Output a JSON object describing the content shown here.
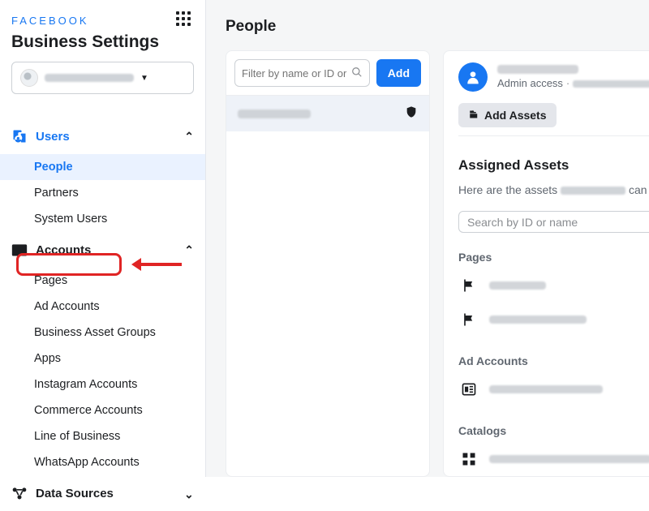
{
  "brand": "FACEBOOK",
  "settings_title": "Business Settings",
  "business_name_blurred": true,
  "sidebar": {
    "sections": [
      {
        "id": "users",
        "label": "Users",
        "accent": true,
        "expanded": true,
        "items": [
          {
            "id": "people",
            "label": "People",
            "active": true
          },
          {
            "id": "partners",
            "label": "Partners",
            "active": false
          },
          {
            "id": "system-users",
            "label": "System Users",
            "active": false
          }
        ]
      },
      {
        "id": "accounts",
        "label": "Accounts",
        "accent": false,
        "expanded": true,
        "items": [
          {
            "id": "pages",
            "label": "Pages",
            "highlight": true
          },
          {
            "id": "ad-accounts",
            "label": "Ad Accounts"
          },
          {
            "id": "business-asset-groups",
            "label": "Business Asset Groups"
          },
          {
            "id": "apps",
            "label": "Apps"
          },
          {
            "id": "instagram-accounts",
            "label": "Instagram Accounts"
          },
          {
            "id": "commerce-accounts",
            "label": "Commerce Accounts"
          },
          {
            "id": "line-of-business",
            "label": "Line of Business"
          },
          {
            "id": "whatsapp-accounts",
            "label": "WhatsApp Accounts"
          }
        ]
      },
      {
        "id": "data-sources",
        "label": "Data Sources",
        "accent": false,
        "expanded": false,
        "items": []
      }
    ]
  },
  "main": {
    "title": "People",
    "filter_placeholder": "Filter by name or ID or Email",
    "add_label": "Add",
    "selected_person_blurred": true,
    "detail": {
      "role": "Admin access",
      "add_assets_label": "Add Assets",
      "assigned_title": "Assigned Assets",
      "description_prefix": "Here are the assets ",
      "description_suffix": " can access. View and manage their permissions, or add or remove assets.",
      "asset_search_placeholder": "Search by ID or name",
      "groups": [
        {
          "title": "Pages",
          "icon": "flag",
          "rows": 2
        },
        {
          "title": "Ad Accounts",
          "icon": "adaccount",
          "rows": 1
        },
        {
          "title": "Catalogs",
          "icon": "catalog",
          "rows": 1
        }
      ]
    }
  }
}
